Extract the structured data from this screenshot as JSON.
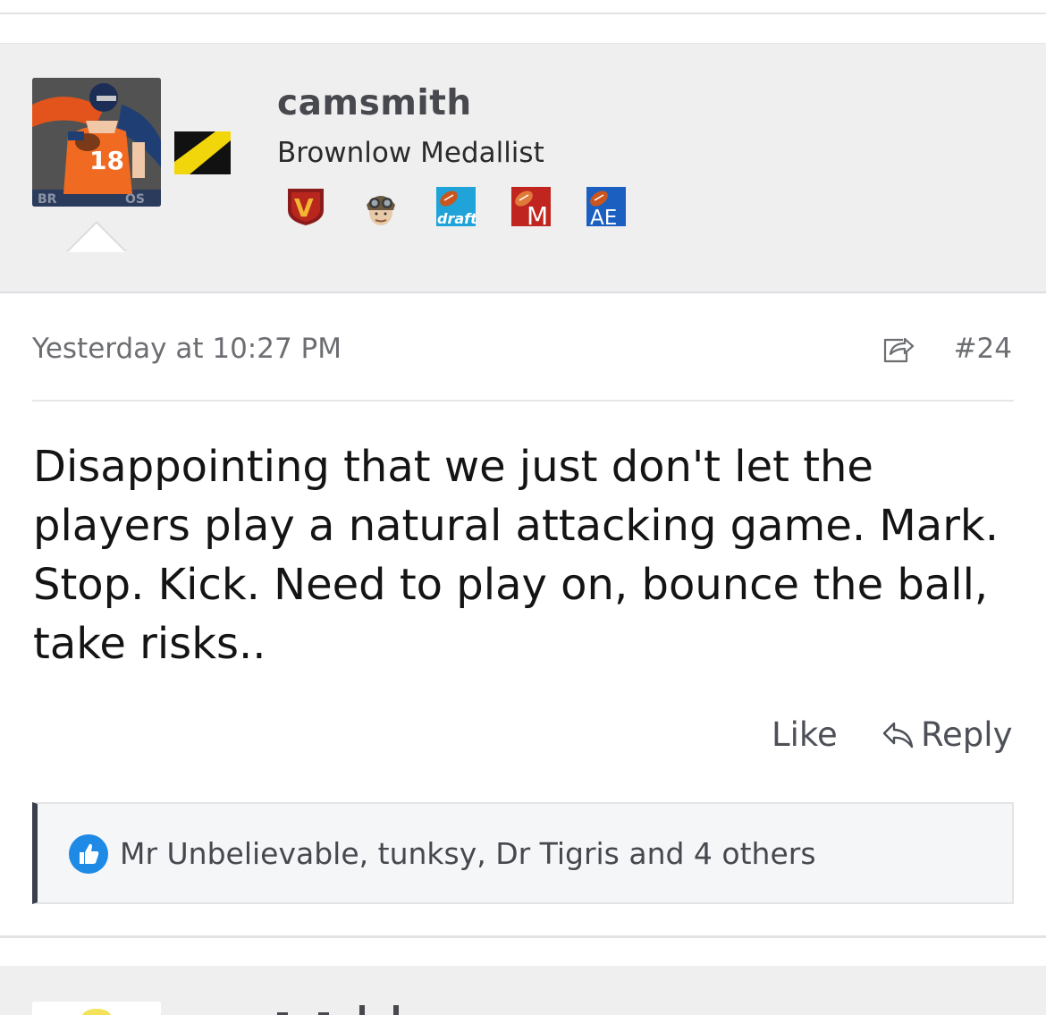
{
  "user": {
    "username": "camsmith",
    "title": "Brownlow Medallist",
    "avatar_icon": "quarterback-avatar",
    "flag_icon": "black-yellow-diagonal-flag",
    "avatar_number": "18",
    "badges": [
      {
        "icon": "v-shield-badge",
        "label": "V"
      },
      {
        "icon": "aviator-helmet-badge",
        "label": ""
      },
      {
        "icon": "draft-football-badge",
        "label": "draft"
      },
      {
        "icon": "m-football-badge",
        "label": "M"
      },
      {
        "icon": "ae-football-badge",
        "label": "AE"
      }
    ]
  },
  "post": {
    "date": "Yesterday at 10:27 PM",
    "number": "#24",
    "body": "Disappointing that we just don't let the players play a natural attacking game. Mark. Stop. Kick. Need to play on, bounce the ball, take risks.."
  },
  "actions": {
    "like_label": "Like",
    "reply_label": "Reply"
  },
  "likes": {
    "text": "Mr Unbelievable, tunksy, Dr Tigris and 4 others"
  },
  "colors": {
    "header_bg": "#efeff0",
    "like_blue": "#1e8ae6",
    "likes_border": "#3a3f4b"
  }
}
